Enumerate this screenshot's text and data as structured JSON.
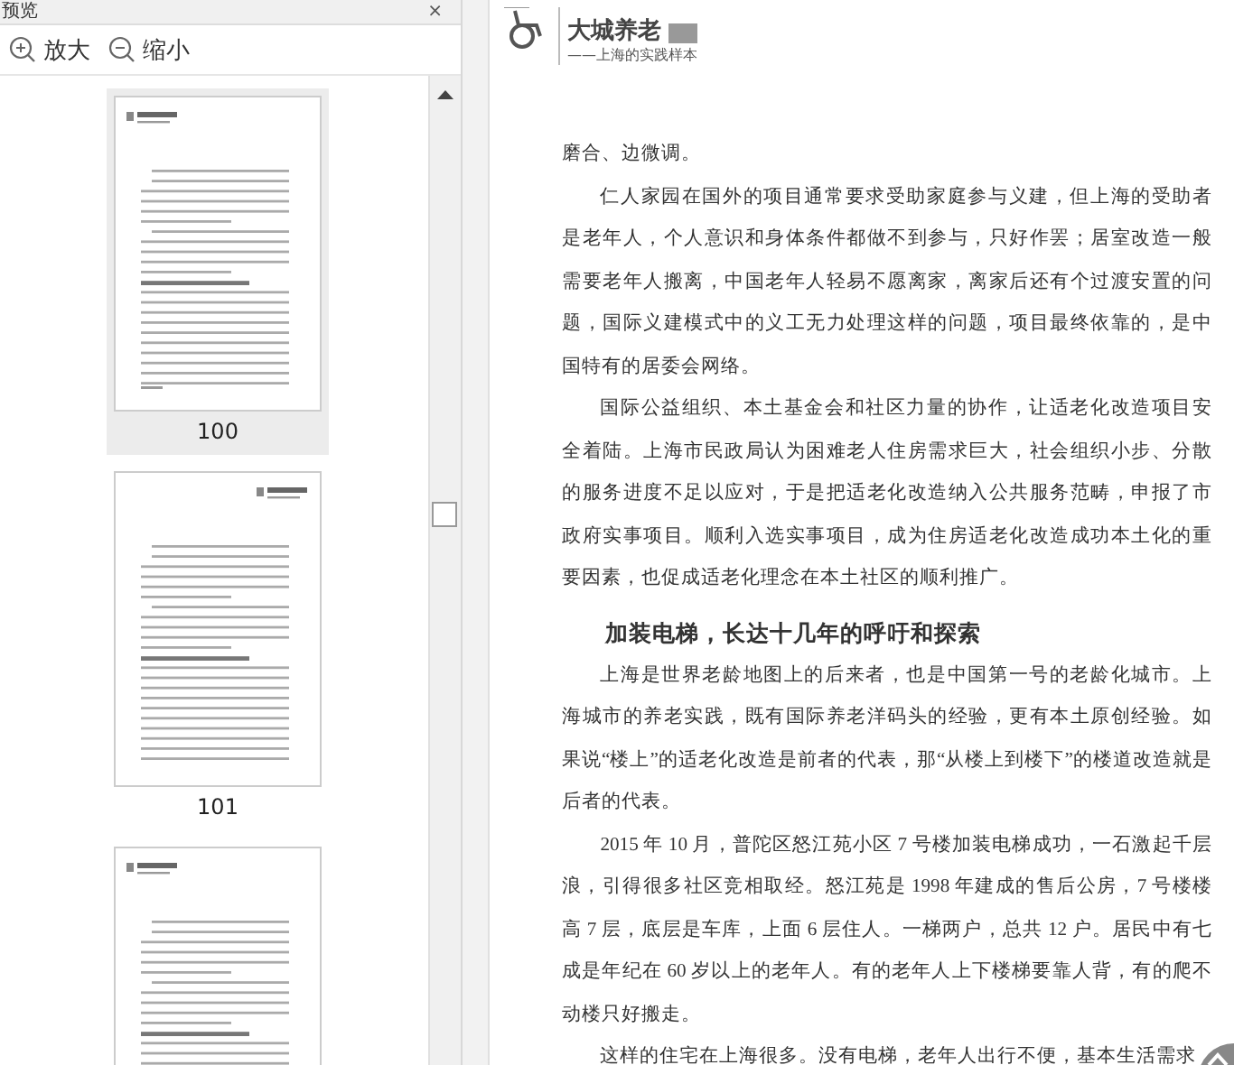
{
  "panel": {
    "title": "预览",
    "close": "×",
    "toolbar": [
      {
        "kind": "zoom-in",
        "label": "放大"
      },
      {
        "kind": "zoom-out",
        "label": "缩小"
      }
    ]
  },
  "thumbnails": [
    {
      "page": "100",
      "selected": true
    },
    {
      "page": "101",
      "selected": false
    },
    {
      "selected": false
    }
  ],
  "document": {
    "header": {
      "title": "大城养老",
      "subtitle": "——上海的实践样本"
    },
    "blocks": [
      {
        "kind": "continuation",
        "text": "磨合、边微调。"
      },
      {
        "kind": "paragraph",
        "text": "仁人家园在国外的项目通常要求受助家庭参与义建，但上海的受助者是老年人，个人意识和身体条件都做不到参与，只好作罢；居室改造一般需要老年人搬离，中国老年人轻易不愿离家，离家后还有个过渡安置的问题，国际义建模式中的义工无力处理这样的问题，项目最终依靠的，是中国特有的居委会网络。"
      },
      {
        "kind": "paragraph",
        "text": "国际公益组织、本土基金会和社区力量的协作，让适老化改造项目安全着陆。上海市民政局认为困难老人住房需求巨大，社会组织小步、分散的服务进度不足以应对，于是把适老化改造纳入公共服务范畴，申报了市政府实事项目。顺利入选实事项目，成为住房适老化改造成功本土化的重要因素，也促成适老化理念在本土社区的顺利推广。"
      },
      {
        "kind": "heading",
        "text": "加装电梯，长达十几年的呼吁和探索"
      },
      {
        "kind": "paragraph",
        "text": "上海是世界老龄地图上的后来者，也是中国第一号的老龄化城市。上海城市的养老实践，既有国际养老洋码头的经验，更有本土原创经验。如果说“楼上”的适老化改造是前者的代表，那“从楼上到楼下”的楼道改造就是后者的代表。"
      },
      {
        "kind": "paragraph",
        "text": "2015 年 10 月，普陀区怒江苑小区 7 号楼加装电梯成功，一石激起千层浪，引得很多社区竞相取经。怒江苑是 1998 年建成的售后公房，7 号楼楼高 7 层，底层是车库，上面 6 层住人。一梯两户，总共 12 户。居民中有七成是年纪在 60 岁以上的老年人。有的老年人上下楼梯要靠人背，有的爬不动楼只好搬走。"
      },
      {
        "kind": "paragraph",
        "text": "这样的住宅在上海很多。没有电梯，老年人出行不便，基本生活需求"
      }
    ]
  }
}
